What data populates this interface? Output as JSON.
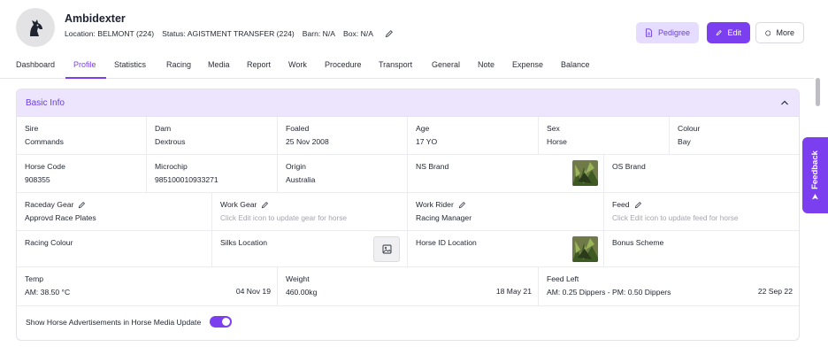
{
  "header": {
    "name": "Ambidexter",
    "location": "Location: BELMONT (224)",
    "status": "Status: AGISTMENT TRANSFER (224)",
    "barn": "Barn: N/A",
    "box": "Box: N/A",
    "buttons": {
      "pedigree": "Pedigree",
      "edit": "Edit",
      "more": "More"
    }
  },
  "tabs": [
    "Dashboard",
    "Profile",
    "Statistics",
    "Racing",
    "Media",
    "Report",
    "Work",
    "Procedure",
    "Transport",
    "General",
    "Note",
    "Expense",
    "Balance"
  ],
  "active_tab": "Profile",
  "feedback_label": "Feedback",
  "basic_info": {
    "title": "Basic Info",
    "row1": [
      {
        "label": "Sire",
        "value": "Commands"
      },
      {
        "label": "Dam",
        "value": "Dextrous"
      },
      {
        "label": "Foaled",
        "value": "25 Nov 2008"
      },
      {
        "label": "Age",
        "value": "17 YO"
      },
      {
        "label": "Sex",
        "value": "Horse"
      },
      {
        "label": "Colour",
        "value": "Bay"
      }
    ],
    "row2": [
      {
        "label": "Horse Code",
        "value": "908355"
      },
      {
        "label": "Microchip",
        "value": "985100010933271"
      },
      {
        "label": "Origin",
        "value": "Australia"
      },
      {
        "label": "NS Brand",
        "value": ""
      },
      {
        "label": "OS Brand",
        "value": ""
      }
    ],
    "row3": [
      {
        "label": "Raceday Gear",
        "value": "Approvd Race Plates"
      },
      {
        "label": "Work Gear",
        "hint": "Click Edit icon to update gear for horse"
      },
      {
        "label": "Work Rider",
        "value": "Racing Manager"
      },
      {
        "label": "Feed",
        "hint": "Click Edit icon to update feed for horse"
      }
    ],
    "row4": [
      {
        "label": "Racing Colour"
      },
      {
        "label": "Silks Location"
      },
      {
        "label": "Horse ID Location"
      },
      {
        "label": "Bonus Scheme"
      }
    ],
    "row5": [
      {
        "label": "Temp",
        "value": "AM: 38.50 °C",
        "date": "04 Nov 19"
      },
      {
        "label": "Weight",
        "value": "460.00kg",
        "date": "18 May 21"
      },
      {
        "label": "Feed Left",
        "value": "AM: 0.25 Dippers - PM: 0.50 Dippers",
        "date": "22 Sep 22"
      }
    ],
    "toggle_label": "Show Horse Advertisements in Horse Media Update",
    "toggle_on": true
  },
  "colors": {
    "accent": "#7b3ff0",
    "accent_light": "#ece5fd",
    "pedigree_bg": "#e6dcff"
  },
  "icons": [
    "horse-head-icon",
    "pencil-icon",
    "document-icon",
    "circle-icon",
    "chevron-up-icon",
    "image-placeholder-icon",
    "arrow-up-icon"
  ]
}
